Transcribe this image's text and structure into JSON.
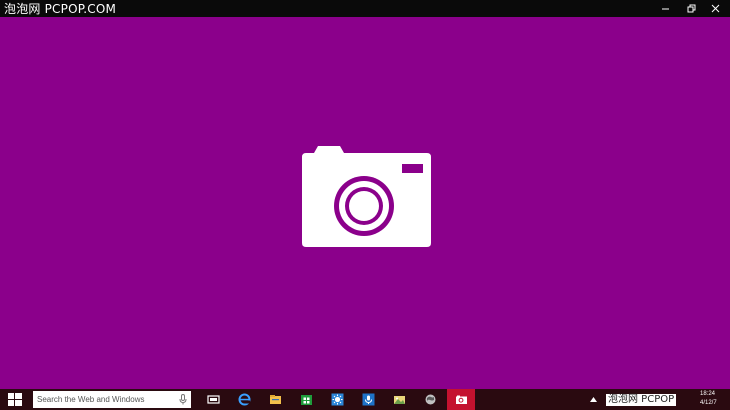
{
  "watermark": {
    "top_left": "泡泡网 PCPOP.COM",
    "bottom_right": "泡泡网 PCPOP"
  },
  "window": {
    "controls": [
      "minimize",
      "restore",
      "close"
    ]
  },
  "app": {
    "name": "Camera",
    "background": "#8b008b",
    "splash_icon": "camera-icon"
  },
  "taskbar": {
    "start_icon": "windows-logo-icon",
    "search_placeholder": "Search the Web and Windows",
    "search_mic_icon": "microphone-icon",
    "pinned": [
      {
        "name": "task-view",
        "icon": "task-view-icon"
      },
      {
        "name": "internet-explorer",
        "icon": "ie-icon"
      },
      {
        "name": "file-explorer",
        "icon": "folder-icon"
      },
      {
        "name": "store",
        "icon": "store-icon"
      },
      {
        "name": "weather",
        "icon": "sun-icon"
      },
      {
        "name": "voice-recorder",
        "icon": "mic-app-icon"
      },
      {
        "name": "photos",
        "icon": "photos-icon"
      },
      {
        "name": "maps",
        "icon": "globe-icon"
      },
      {
        "name": "camera",
        "icon": "camera-icon",
        "active": true
      }
    ],
    "tray": {
      "up_arrow_icon": "chevron-up-icon",
      "time": "18:24",
      "date": "4/12/7"
    },
    "accent": "#c4122f"
  }
}
